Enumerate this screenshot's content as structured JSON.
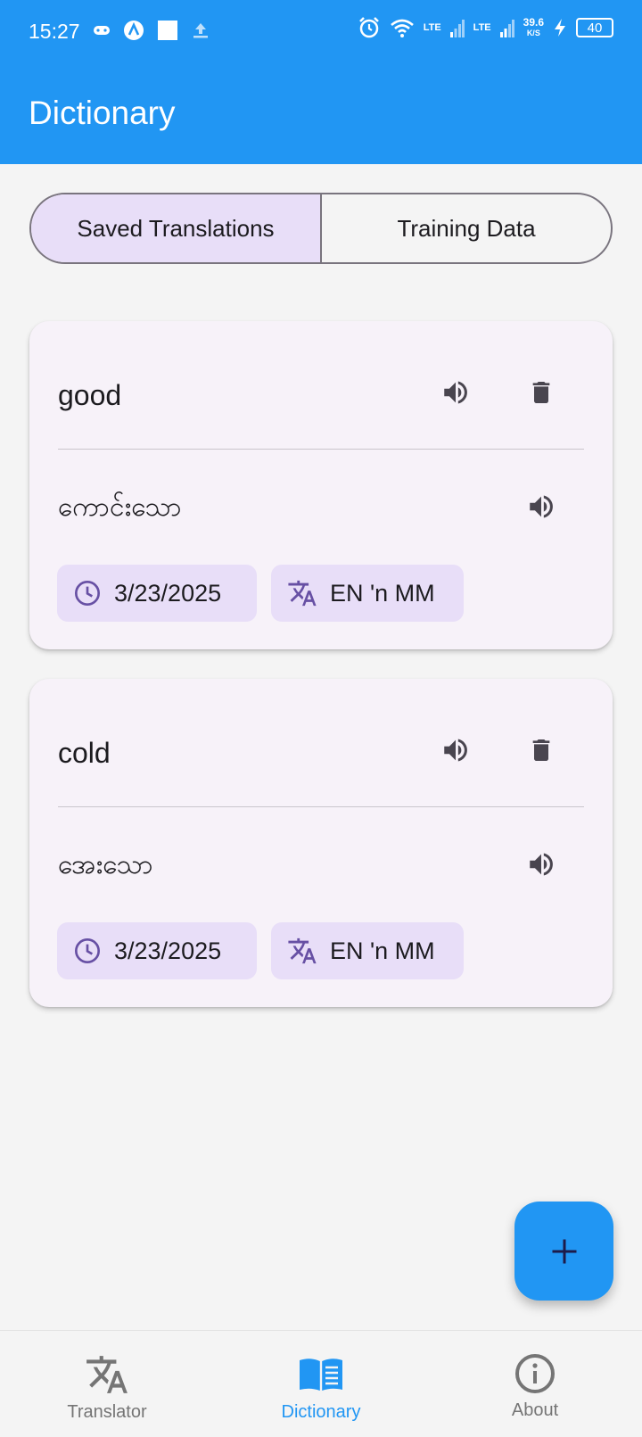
{
  "status_bar": {
    "time": "15:27",
    "lte1": "LTE",
    "lte2": "LTE",
    "speed_value": "39.6",
    "speed_unit": "K/S",
    "battery": "40"
  },
  "app_bar": {
    "title": "Dictionary"
  },
  "segmented": {
    "options": [
      {
        "label": "Saved Translations",
        "selected": true
      },
      {
        "label": "Training Data",
        "selected": false
      }
    ]
  },
  "entries": [
    {
      "word": "good",
      "translation": "ကောင်းသော",
      "date": "3/23/2025",
      "language": "EN 'n  MM"
    },
    {
      "word": "cold",
      "translation": "အေးသော",
      "date": "3/23/2025",
      "language": "EN 'n  MM"
    }
  ],
  "fab": {
    "icon": "plus-icon"
  },
  "bottom_nav": {
    "items": [
      {
        "label": "Translator",
        "icon": "translate-icon",
        "active": false
      },
      {
        "label": "Dictionary",
        "icon": "book-icon",
        "active": true
      },
      {
        "label": "About",
        "icon": "info-icon",
        "active": false
      }
    ]
  },
  "colors": {
    "primary": "#2196f3",
    "chip": "#e8def8",
    "card": "#f7f2f9",
    "accent_icon": "#6750a4"
  }
}
